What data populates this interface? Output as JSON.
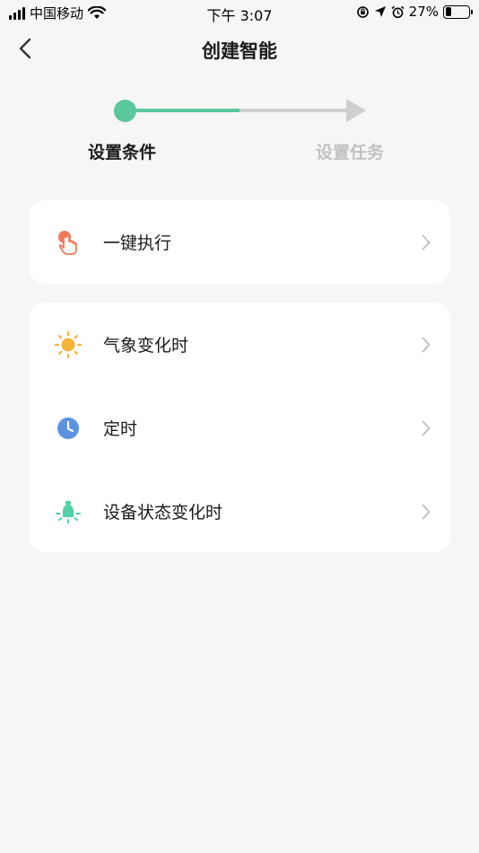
{
  "status_bar": {
    "carrier": "中国移动",
    "time": "下午 3:07",
    "battery": "27%",
    "battery_level": 0.27
  },
  "nav": {
    "title": "创建智能",
    "back_icon": "chevron-left-icon"
  },
  "stepper": {
    "steps": [
      {
        "label": "设置条件",
        "state": "active"
      },
      {
        "label": "设置任务",
        "state": "inactive"
      }
    ],
    "active_color": "#5bc79c",
    "inactive_color": "#cfcfcf"
  },
  "conditions": {
    "group1": [
      {
        "label": "一键执行",
        "icon": "tap-hand-icon",
        "color": "#ef7a58"
      }
    ],
    "group2": [
      {
        "label": "气象变化时",
        "icon": "sun-icon",
        "color": "#f6b43a"
      },
      {
        "label": "定时",
        "icon": "clock-icon",
        "color": "#5b93e0"
      },
      {
        "label": "设备状态变化时",
        "icon": "bulb-icon",
        "color": "#4fd1a5"
      }
    ]
  }
}
